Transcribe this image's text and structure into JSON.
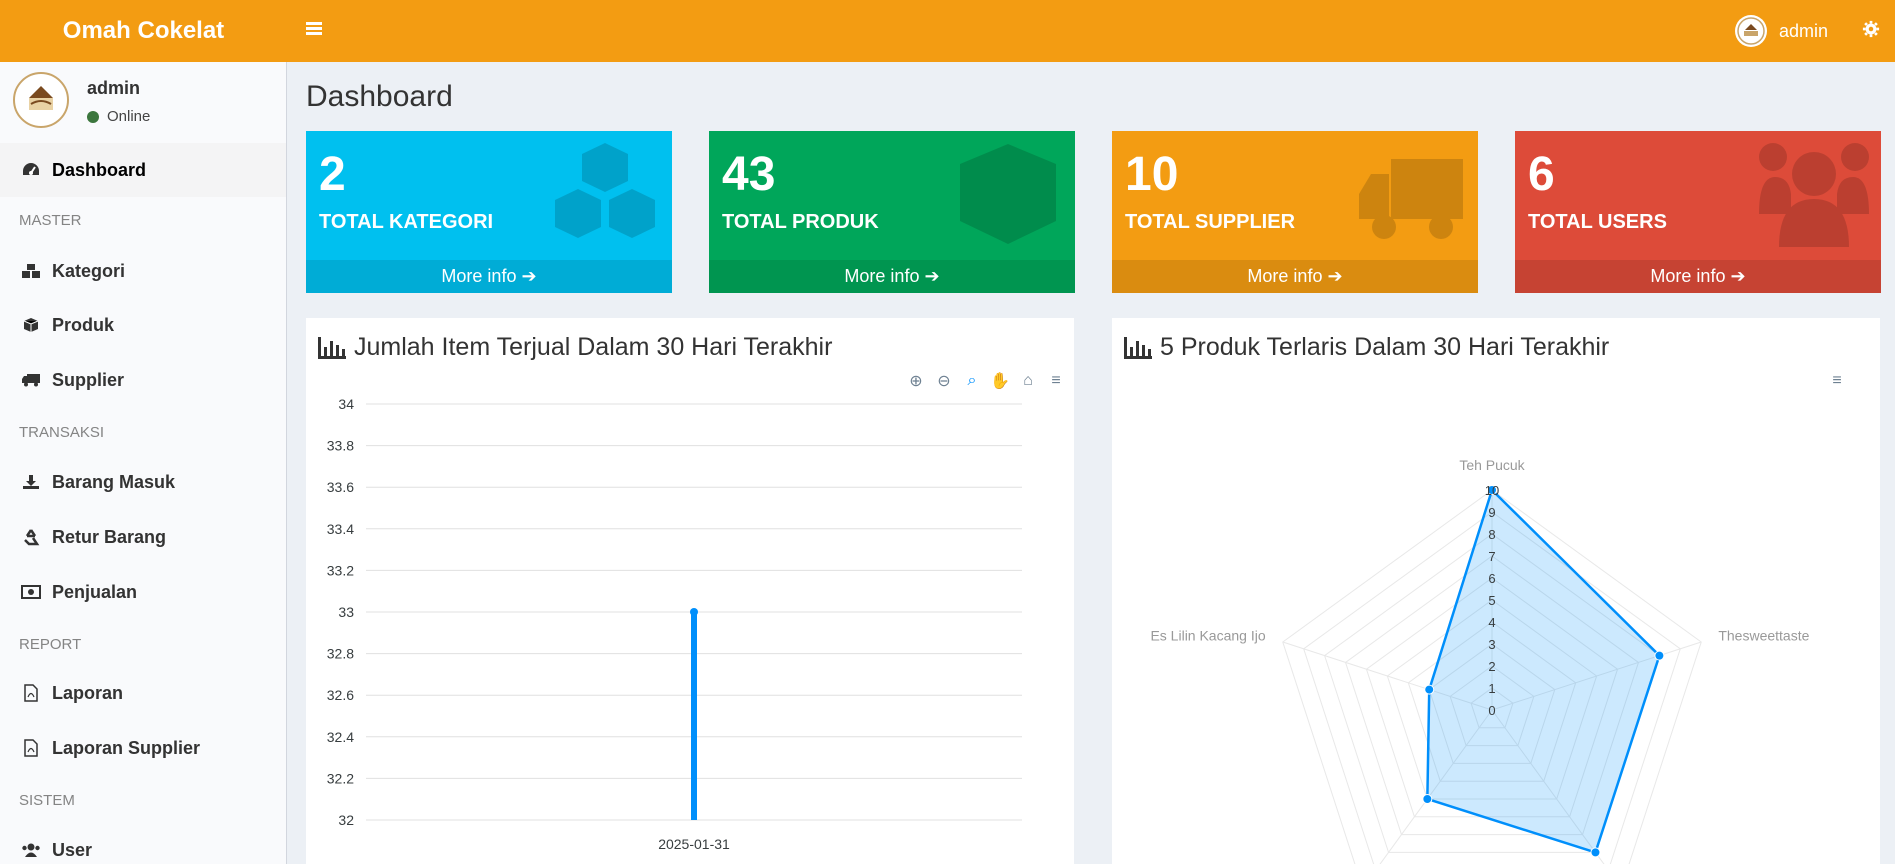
{
  "header": {
    "brand": "Omah Cokelat",
    "user_name": "admin"
  },
  "sidebar": {
    "user_name": "admin",
    "status": "Online",
    "items": [
      {
        "label": "Dashboard",
        "icon": "dashboard-icon"
      },
      {
        "label": "Kategori",
        "icon": "cubes-icon"
      },
      {
        "label": "Produk",
        "icon": "cube-icon"
      },
      {
        "label": "Supplier",
        "icon": "truck-icon"
      },
      {
        "label": "Barang Masuk",
        "icon": "download-icon"
      },
      {
        "label": "Retur Barang",
        "icon": "recycle-icon"
      },
      {
        "label": "Penjualan",
        "icon": "money-icon"
      },
      {
        "label": "Laporan",
        "icon": "file-pdf-icon"
      },
      {
        "label": "Laporan Supplier",
        "icon": "file-pdf-icon"
      },
      {
        "label": "User",
        "icon": "users-icon"
      }
    ],
    "sections": [
      "MASTER",
      "TRANSAKSI",
      "REPORT",
      "SISTEM"
    ]
  },
  "page": {
    "title": "Dashboard"
  },
  "stats": [
    {
      "value": "2",
      "label": "TOTAL KATEGORI",
      "footer": "More info",
      "color": "#00c0ef",
      "icon": "cubes-icon"
    },
    {
      "value": "43",
      "label": "TOTAL PRODUK",
      "footer": "More info",
      "color": "#00a65a",
      "icon": "cube-icon"
    },
    {
      "value": "10",
      "label": "TOTAL SUPPLIER",
      "footer": "More info",
      "color": "#f39c12",
      "icon": "truck-icon"
    },
    {
      "value": "6",
      "label": "TOTAL USERS",
      "footer": "More info",
      "color": "#dd4b39",
      "icon": "users-icon"
    }
  ],
  "panels": {
    "left_title": "Jumlah Item Terjual Dalam 30 Hari Terakhir",
    "right_title": "5 Produk Terlaris Dalam 30 Hari Terakhir"
  },
  "chart_data": [
    {
      "type": "bar",
      "title": "Jumlah Item Terjual Dalam 30 Hari Terakhir",
      "categories": [
        "2025-01-31"
      ],
      "values": [
        33
      ],
      "ylim": [
        32,
        34
      ],
      "yticks": [
        "34",
        "33.8",
        "33.6",
        "33.4",
        "33.2",
        "33",
        "32.8",
        "32.6",
        "32.4",
        "32.2",
        "32"
      ],
      "grid": true,
      "color": "#008ffb"
    },
    {
      "type": "radar",
      "title": "5 Produk Terlaris Dalam 30 Hari Terakhir",
      "categories": [
        "Teh Pucuk",
        "Thesweettaste",
        "",
        "",
        "Es Lilin Kacang Ijo"
      ],
      "values": [
        10,
        8,
        8,
        5,
        3
      ],
      "rlim": [
        0,
        10
      ],
      "rticks": [
        "0",
        "1",
        "2",
        "3",
        "4",
        "5",
        "6",
        "7",
        "8",
        "9",
        "10"
      ],
      "color": "#008ffb"
    }
  ]
}
